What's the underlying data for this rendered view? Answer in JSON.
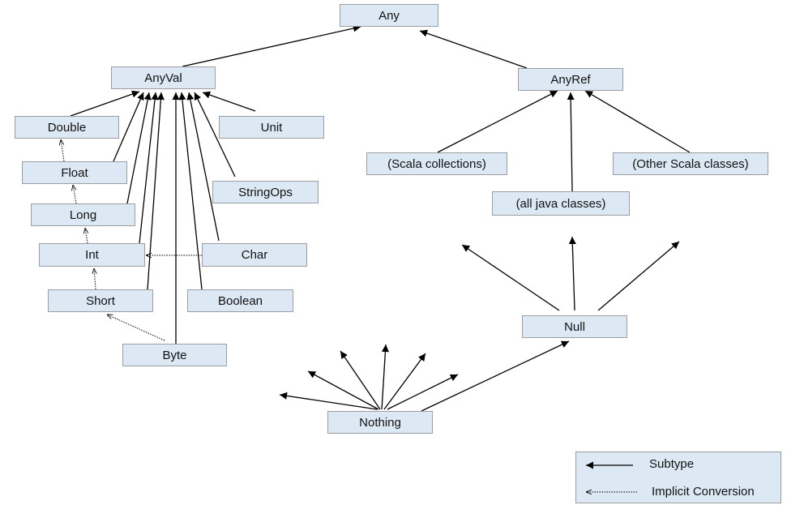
{
  "nodes": {
    "any": "Any",
    "anyval": "AnyVal",
    "anyref": "AnyRef",
    "double": "Double",
    "float": "Float",
    "long": "Long",
    "int": "Int",
    "short": "Short",
    "byte": "Byte",
    "unit": "Unit",
    "stringops": "StringOps",
    "char": "Char",
    "boolean": "Boolean",
    "scala_collections": "(Scala collections)",
    "java_classes": "(all java classes)",
    "other_scala": "(Other Scala classes)",
    "null": "Null",
    "nothing": "Nothing"
  },
  "edges": {
    "subtype": [
      [
        "anyval",
        "any"
      ],
      [
        "anyref",
        "any"
      ],
      [
        "double",
        "anyval"
      ],
      [
        "float",
        "anyval"
      ],
      [
        "long",
        "anyval"
      ],
      [
        "int",
        "anyval"
      ],
      [
        "short",
        "anyval"
      ],
      [
        "byte",
        "anyval"
      ],
      [
        "unit",
        "anyval"
      ],
      [
        "stringops",
        "anyval"
      ],
      [
        "char",
        "anyval"
      ],
      [
        "boolean",
        "anyval"
      ],
      [
        "scala_collections",
        "anyref"
      ],
      [
        "java_classes",
        "anyref"
      ],
      [
        "other_scala",
        "anyref"
      ],
      [
        "nothing",
        "null"
      ]
    ],
    "implicit_conversion": [
      [
        "float",
        "double"
      ],
      [
        "long",
        "float"
      ],
      [
        "int",
        "long"
      ],
      [
        "short",
        "int"
      ],
      [
        "byte",
        "short"
      ],
      [
        "char",
        "int"
      ]
    ]
  },
  "legend": {
    "subtype": "Subtype",
    "implicit": "Implicit Conversion"
  }
}
